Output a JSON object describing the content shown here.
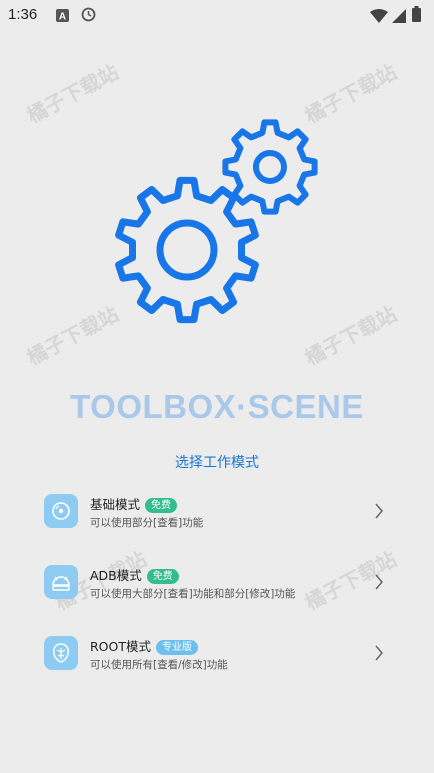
{
  "status_bar": {
    "time": "1:36",
    "icons": [
      "a-notification-icon",
      "clock-icon",
      "wifi-icon",
      "signal-icon",
      "battery-icon"
    ]
  },
  "watermark_text": "橘子下载站",
  "app": {
    "title": "TOOLBOX·SCENE",
    "title_color": "#a9c8ea",
    "gear_color": "#1976e8"
  },
  "mode_select_title": "选择工作模式",
  "modes": [
    {
      "name": "基础模式",
      "badge": "免费",
      "desc": "可以使用部分[查看]功能",
      "icon": "disc-icon"
    },
    {
      "name": "ADB模式",
      "badge": "免费",
      "desc": "可以使用大部分[查看]功能和部分[修改]功能",
      "icon": "android-icon"
    },
    {
      "name": "ROOT模式",
      "badge": "专业版",
      "desc": "可以使用所有[查看/修改]功能",
      "icon": "root-icon"
    }
  ],
  "colors": {
    "accent": "#1976d2",
    "badge_free": "#34bd8e",
    "badge_pro": "#6ebfee",
    "mode_icon_bg": "#8ecbf3"
  }
}
